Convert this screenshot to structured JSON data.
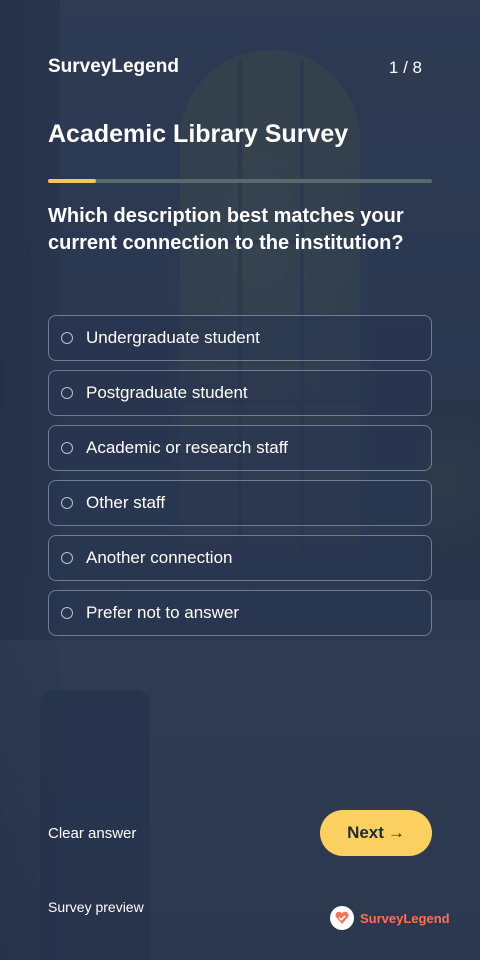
{
  "header": {
    "brand": "SurveyLegend",
    "progress_text": "1 / 8",
    "title": "Academic Library Survey",
    "progress_fraction": 0.125
  },
  "question": {
    "text": "Which description best matches your current connection to the institution?",
    "options": [
      "Undergraduate student",
      "Postgraduate student",
      "Academic or research staff",
      "Other staff",
      "Another connection",
      "Prefer not to answer"
    ]
  },
  "actions": {
    "clear_label": "Clear answer",
    "next_label": "Next",
    "next_arrow": "→"
  },
  "footer": {
    "preview_label": "Survey preview",
    "brand_wordmark": "SurveyLegend"
  },
  "colors": {
    "accent": "#fcd060",
    "progress_fill": "#f5c65a",
    "brand_logo": "#ff6e55"
  }
}
